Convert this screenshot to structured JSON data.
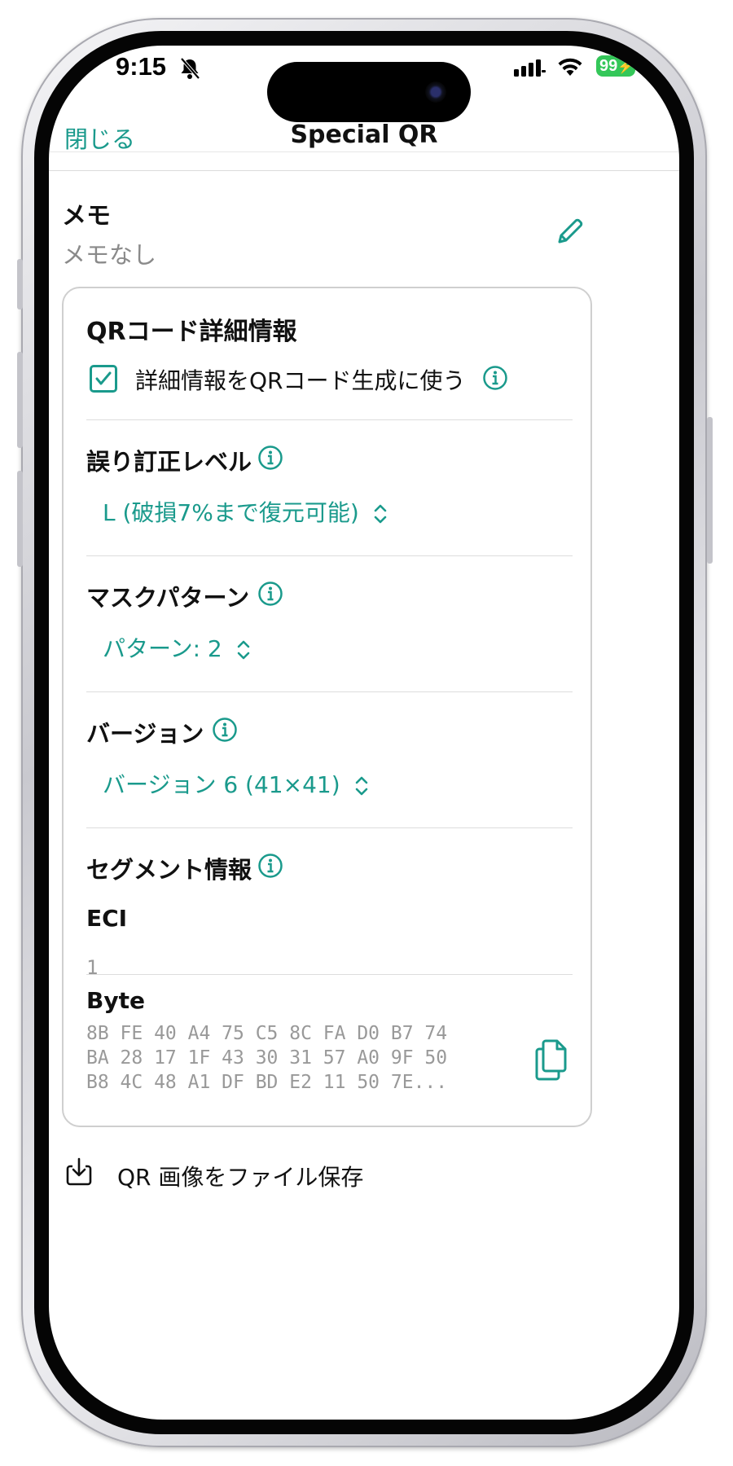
{
  "status_bar": {
    "time": "9:15",
    "battery": "99"
  },
  "nav": {
    "close_label": "閉じる",
    "title": "Special QR"
  },
  "memo": {
    "label": "メモ",
    "value": "メモなし"
  },
  "qr_details": {
    "title": "QRコード詳細情報",
    "use_checkbox_label": "詳細情報をQRコード生成に使う",
    "use_checkbox_checked": true,
    "error_correction": {
      "label": "誤り訂正レベル",
      "value": "L (破損7%まで復元可能)"
    },
    "mask_pattern": {
      "label": "マスクパターン",
      "value": "パターン: 2"
    },
    "version": {
      "label": "バージョン",
      "value": "バージョン 6 (41×41)"
    },
    "segments": {
      "label": "セグメント情報",
      "eci_label": "ECI",
      "eci_value": "1",
      "byte_label": "Byte",
      "byte_lines": [
        "8B FE 40 A4 75 C5 8C FA D0 B7 74",
        "BA 28 17 1F 43 30 31 57 A0 9F 50",
        "B8 4C 48 A1 DF BD E2 11 50 7E..."
      ]
    }
  },
  "actions": {
    "save_label": "QR 画像をファイル保存"
  },
  "colors": {
    "accent": "#1a9a8c",
    "battery": "#34c759"
  }
}
